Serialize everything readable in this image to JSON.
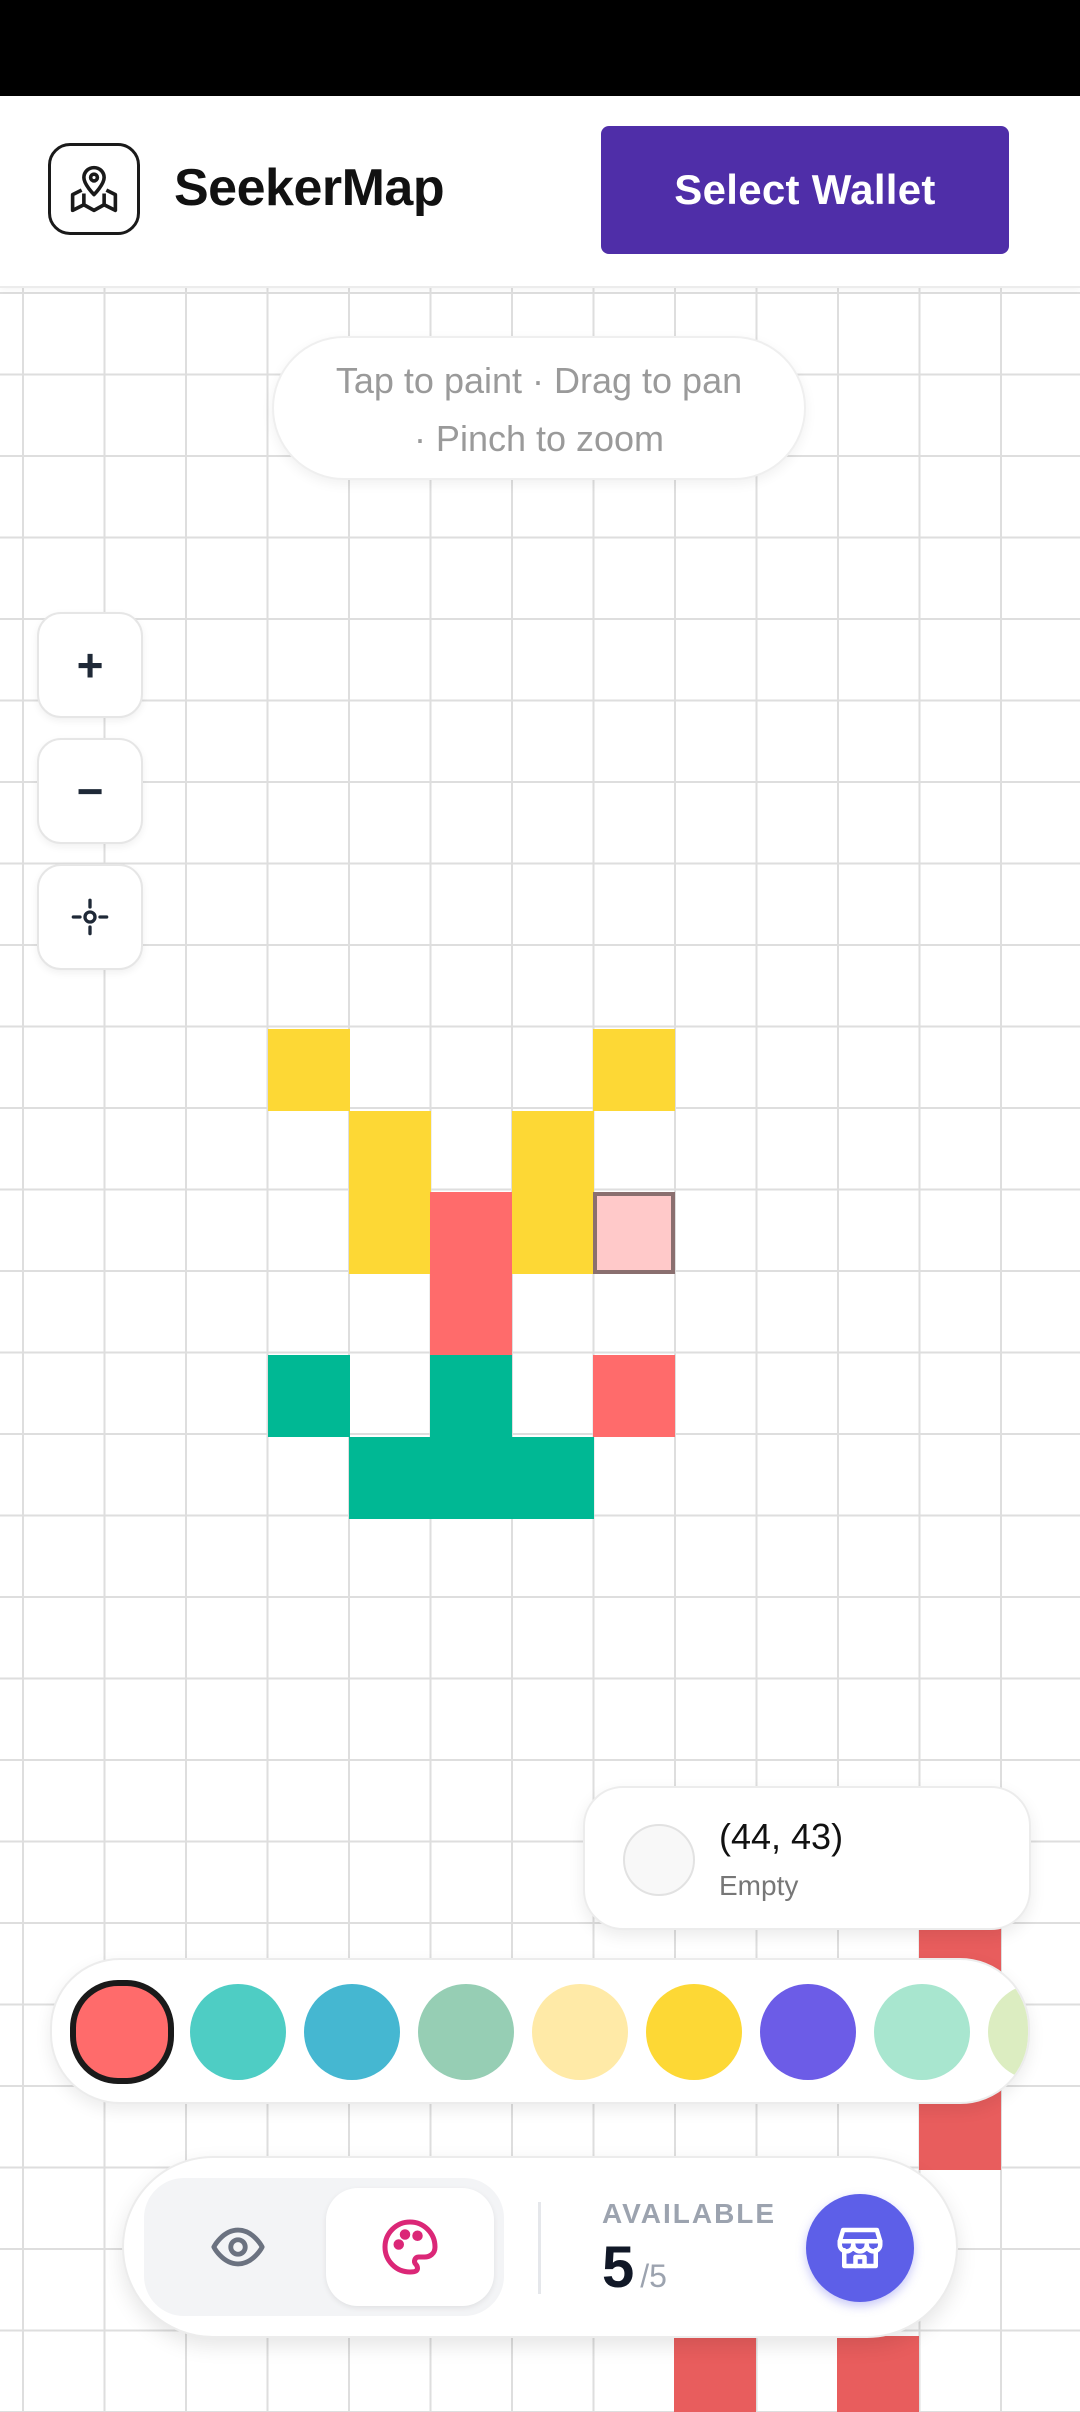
{
  "app": {
    "name": "SeekerMap"
  },
  "header": {
    "wallet_button_label": "Select Wallet"
  },
  "hint": {
    "line1": "Tap to paint · Drag to pan",
    "line2": "· Pinch to zoom"
  },
  "zoom": {
    "in_label": "+",
    "out_label": "−"
  },
  "icons": {
    "logo": "map-pin-icon",
    "recenter": "crosshair-icon",
    "view": "eye-icon",
    "paint": "palette-icon",
    "shop": "store-icon"
  },
  "info_card": {
    "coords": "(44, 43)",
    "state": "Empty"
  },
  "palette": {
    "selected_index": 0,
    "colors": [
      "#ff6b6b",
      "#4ecdc4",
      "#45b7d1",
      "#96ceb4",
      "#ffeaa7",
      "#fdd835",
      "#6c5ce7",
      "#a8e6cf",
      "#dcedc1"
    ]
  },
  "status": {
    "available_label": "AVAILABLE",
    "available_count": "5",
    "available_max": "/5"
  },
  "colors": {
    "accent": "#4f2ea8",
    "shop": "#5d5fe8",
    "yellow": "#fdd835",
    "red": "#ff6b6b",
    "green": "#00b894",
    "preview": "#ffc9c9"
  }
}
